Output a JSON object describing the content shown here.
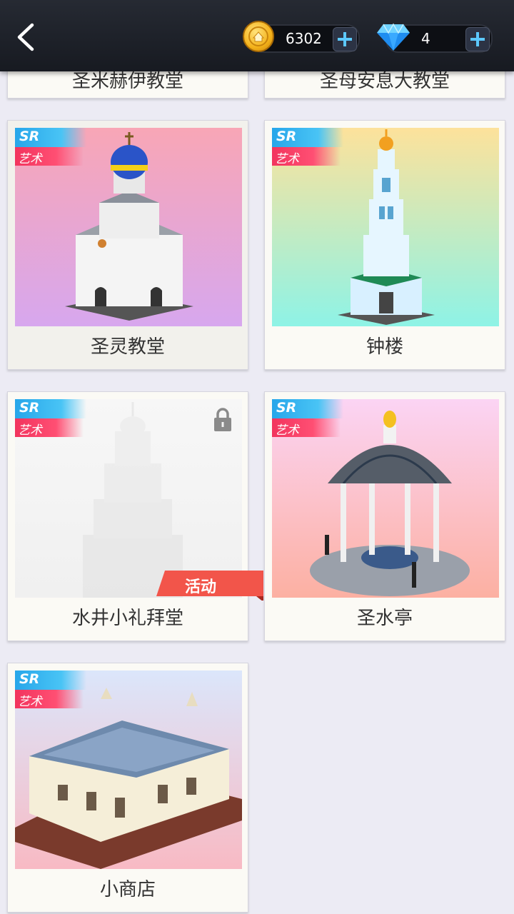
{
  "header": {
    "coins": "6302",
    "gems": "4",
    "icons": [
      "back-arrow-icon",
      "coin-icon",
      "plus-icon",
      "diamond-icon",
      "plus-icon"
    ]
  },
  "top_partial_cards": [
    {
      "title": "圣米赫伊教堂"
    },
    {
      "title": "圣母安息大教堂"
    }
  ],
  "cards": [
    {
      "title": "圣灵教堂",
      "rarity": "SR",
      "category": "艺术",
      "bg": [
        "#f9a3b3",
        "#d9a3ee"
      ],
      "locked": false,
      "selected": true
    },
    {
      "title": "钟楼",
      "rarity": "SR",
      "category": "艺术",
      "bg": [
        "#fde39b",
        "#8ef4e6"
      ],
      "locked": false
    },
    {
      "title": "水井小礼拜堂",
      "rarity": "SR",
      "category": "艺术",
      "bg": [
        "#f6f6f6",
        "#f1f1f1"
      ],
      "locked": true,
      "event_label": "活动"
    },
    {
      "title": "圣水亭",
      "rarity": "SR",
      "category": "艺术",
      "bg": [
        "#fbd3f3",
        "#fcb1a4"
      ],
      "locked": false
    },
    {
      "title": "小商店",
      "rarity": "SR",
      "category": "艺术",
      "bg": [
        "#d9e6fb",
        "#f8b9c3"
      ],
      "locked": false
    }
  ],
  "colors": {
    "accent_blue": "#38b8f2",
    "accent_red": "#f33d63",
    "event_red": "#f2554a"
  }
}
